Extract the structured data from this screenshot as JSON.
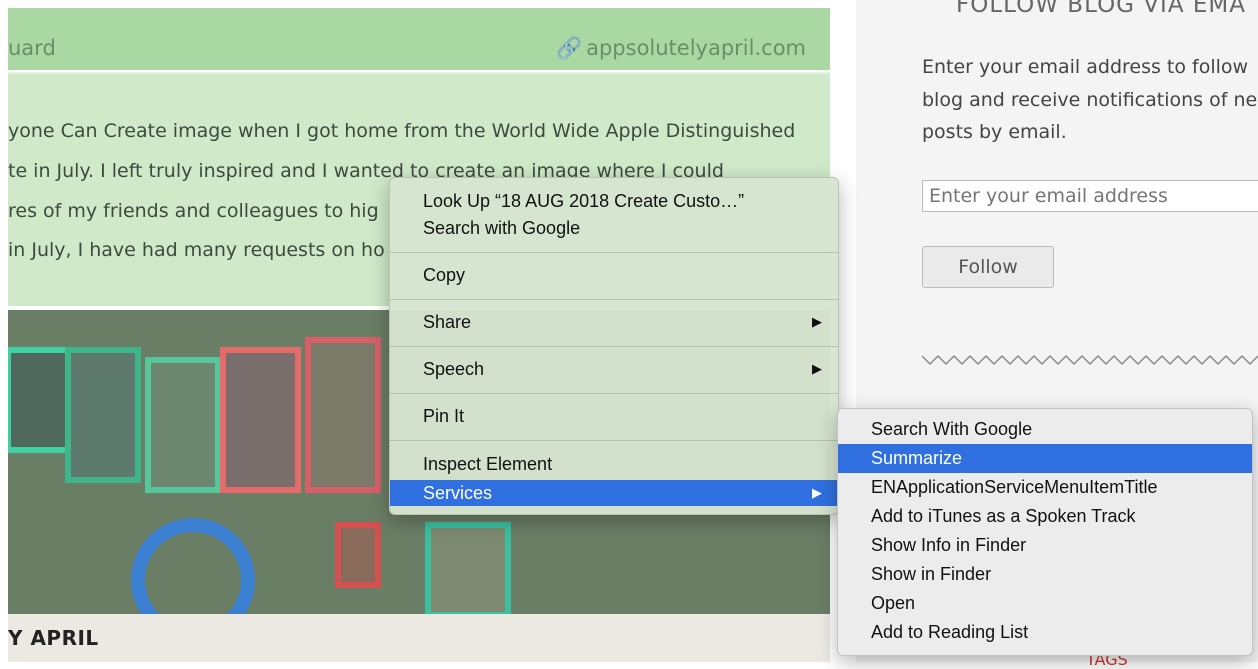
{
  "article": {
    "author_partial": "uard",
    "site_link": "appsolutelyapril.com",
    "lines": [
      "yone Can Create image when I got home from the World Wide Apple Distinguished",
      "te in July. I left truly inspired and I wanted to create an image where I could",
      "res of my friends and colleagues to hig",
      "in July, I have had many requests on ho"
    ],
    "bottom_bar": "Y APRIL"
  },
  "sidebar": {
    "heading": "FOLLOW BLOG VIA EMA",
    "description": [
      "Enter your email address to follow",
      "blog and receive notifications of ne",
      "posts by email."
    ],
    "email_placeholder": "Enter your email address",
    "follow_label": "Follow",
    "tags_partial": "TAGS"
  },
  "context_menu": {
    "items": [
      {
        "label": "Look Up “18 AUG 2018 Create Custo…”"
      },
      {
        "label": "Search with Google"
      },
      {
        "label": "Copy"
      },
      {
        "label": "Share",
        "submenu": true
      },
      {
        "label": "Speech",
        "submenu": true
      },
      {
        "label": "Pin It"
      },
      {
        "label": "Inspect Element"
      },
      {
        "label": "Services",
        "submenu": true,
        "active": true
      }
    ],
    "arrow_glyph": "▶"
  },
  "services_submenu": {
    "items": [
      {
        "label": "Search With Google"
      },
      {
        "label": "Summarize",
        "active": true
      },
      {
        "label": "ENApplicationServiceMenuItemTitle"
      },
      {
        "label": "Add to iTunes as a Spoken Track"
      },
      {
        "label": "Show Info in Finder"
      },
      {
        "label": "Show in Finder"
      },
      {
        "label": "Open"
      },
      {
        "label": "Add to Reading List"
      }
    ]
  },
  "colors": {
    "highlight": "#2f6fe0",
    "header_green": "#a9d8a2",
    "text_green_bg": "#cfe9c9"
  },
  "icons": {
    "link": "link-icon",
    "submenu_arrow": "triangle-right-icon"
  }
}
